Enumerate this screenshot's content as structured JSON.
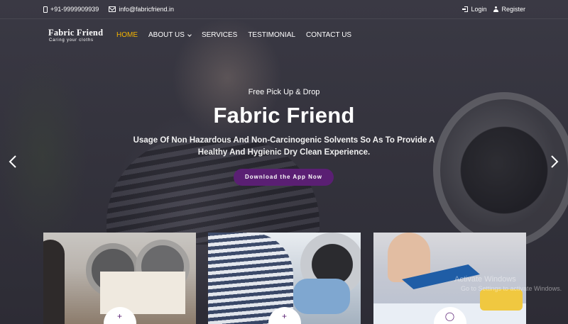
{
  "topbar": {
    "phone": "+91-9999909939",
    "email": "info@fabricfriend.in",
    "login_label": "Login",
    "register_label": "Register"
  },
  "brand": {
    "name": "Fabric Friend",
    "tagline": "Caring your cloths"
  },
  "nav": {
    "items": [
      {
        "label": "HOME",
        "active": true
      },
      {
        "label": "ABOUT US",
        "has_dropdown": true
      },
      {
        "label": "SERVICES"
      },
      {
        "label": "TESTIMONIAL"
      },
      {
        "label": "CONTACT US"
      }
    ]
  },
  "hero": {
    "eyebrow": "Free Pick Up & Drop",
    "headline": "Fabric Friend",
    "description": "Usage Of Non Hazardous And Non-Carcinogenic Solvents So As To Provide A Healthy And Hygienic Dry Clean Experience.",
    "cta_label": "Download the App Now",
    "cta_color": "#5a1f73"
  },
  "colors": {
    "active_nav": "#f5b500",
    "accent": "#5a1f73"
  },
  "icons": {
    "topbar": [
      "phone-icon",
      "mail-icon",
      "login-icon",
      "user-icon"
    ],
    "slider": [
      "chevron-left-icon",
      "chevron-right-icon"
    ]
  },
  "cards": [
    {
      "icon": "plus-icon"
    },
    {
      "icon": "plus-icon"
    },
    {
      "icon": "laundry-icon"
    }
  ],
  "watermark": {
    "line1": "Activate Windows",
    "line2": "Go to Settings to activate Windows."
  }
}
